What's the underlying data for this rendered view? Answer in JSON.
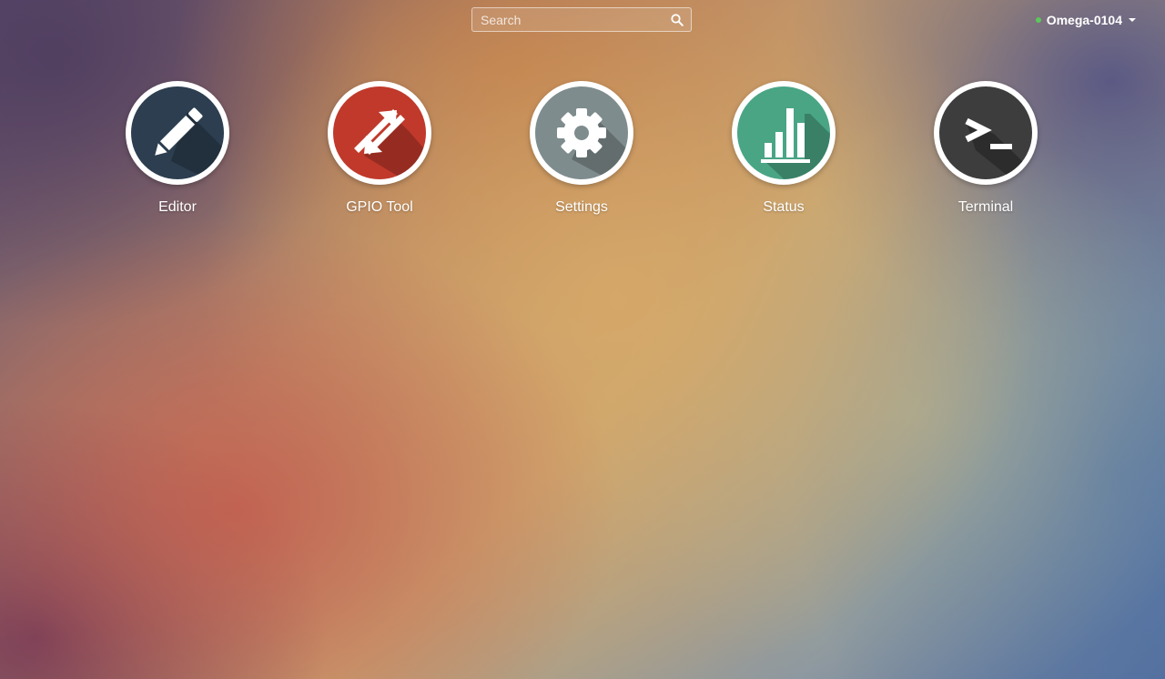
{
  "search": {
    "placeholder": "Search"
  },
  "device": {
    "name": "Omega-0104",
    "status_color": "#5cc75c"
  },
  "apps": [
    {
      "label": "Editor",
      "icon": "pencil-icon",
      "color": "#2c3e50"
    },
    {
      "label": "GPIO Tool",
      "icon": "arrows-exchange-icon",
      "color": "#c0392b"
    },
    {
      "label": "Settings",
      "icon": "gear-icon",
      "color": "#7f8c8d"
    },
    {
      "label": "Status",
      "icon": "bar-chart-icon",
      "color": "#4aa585"
    },
    {
      "label": "Terminal",
      "icon": "terminal-icon",
      "color": "#3d3d3d"
    }
  ]
}
